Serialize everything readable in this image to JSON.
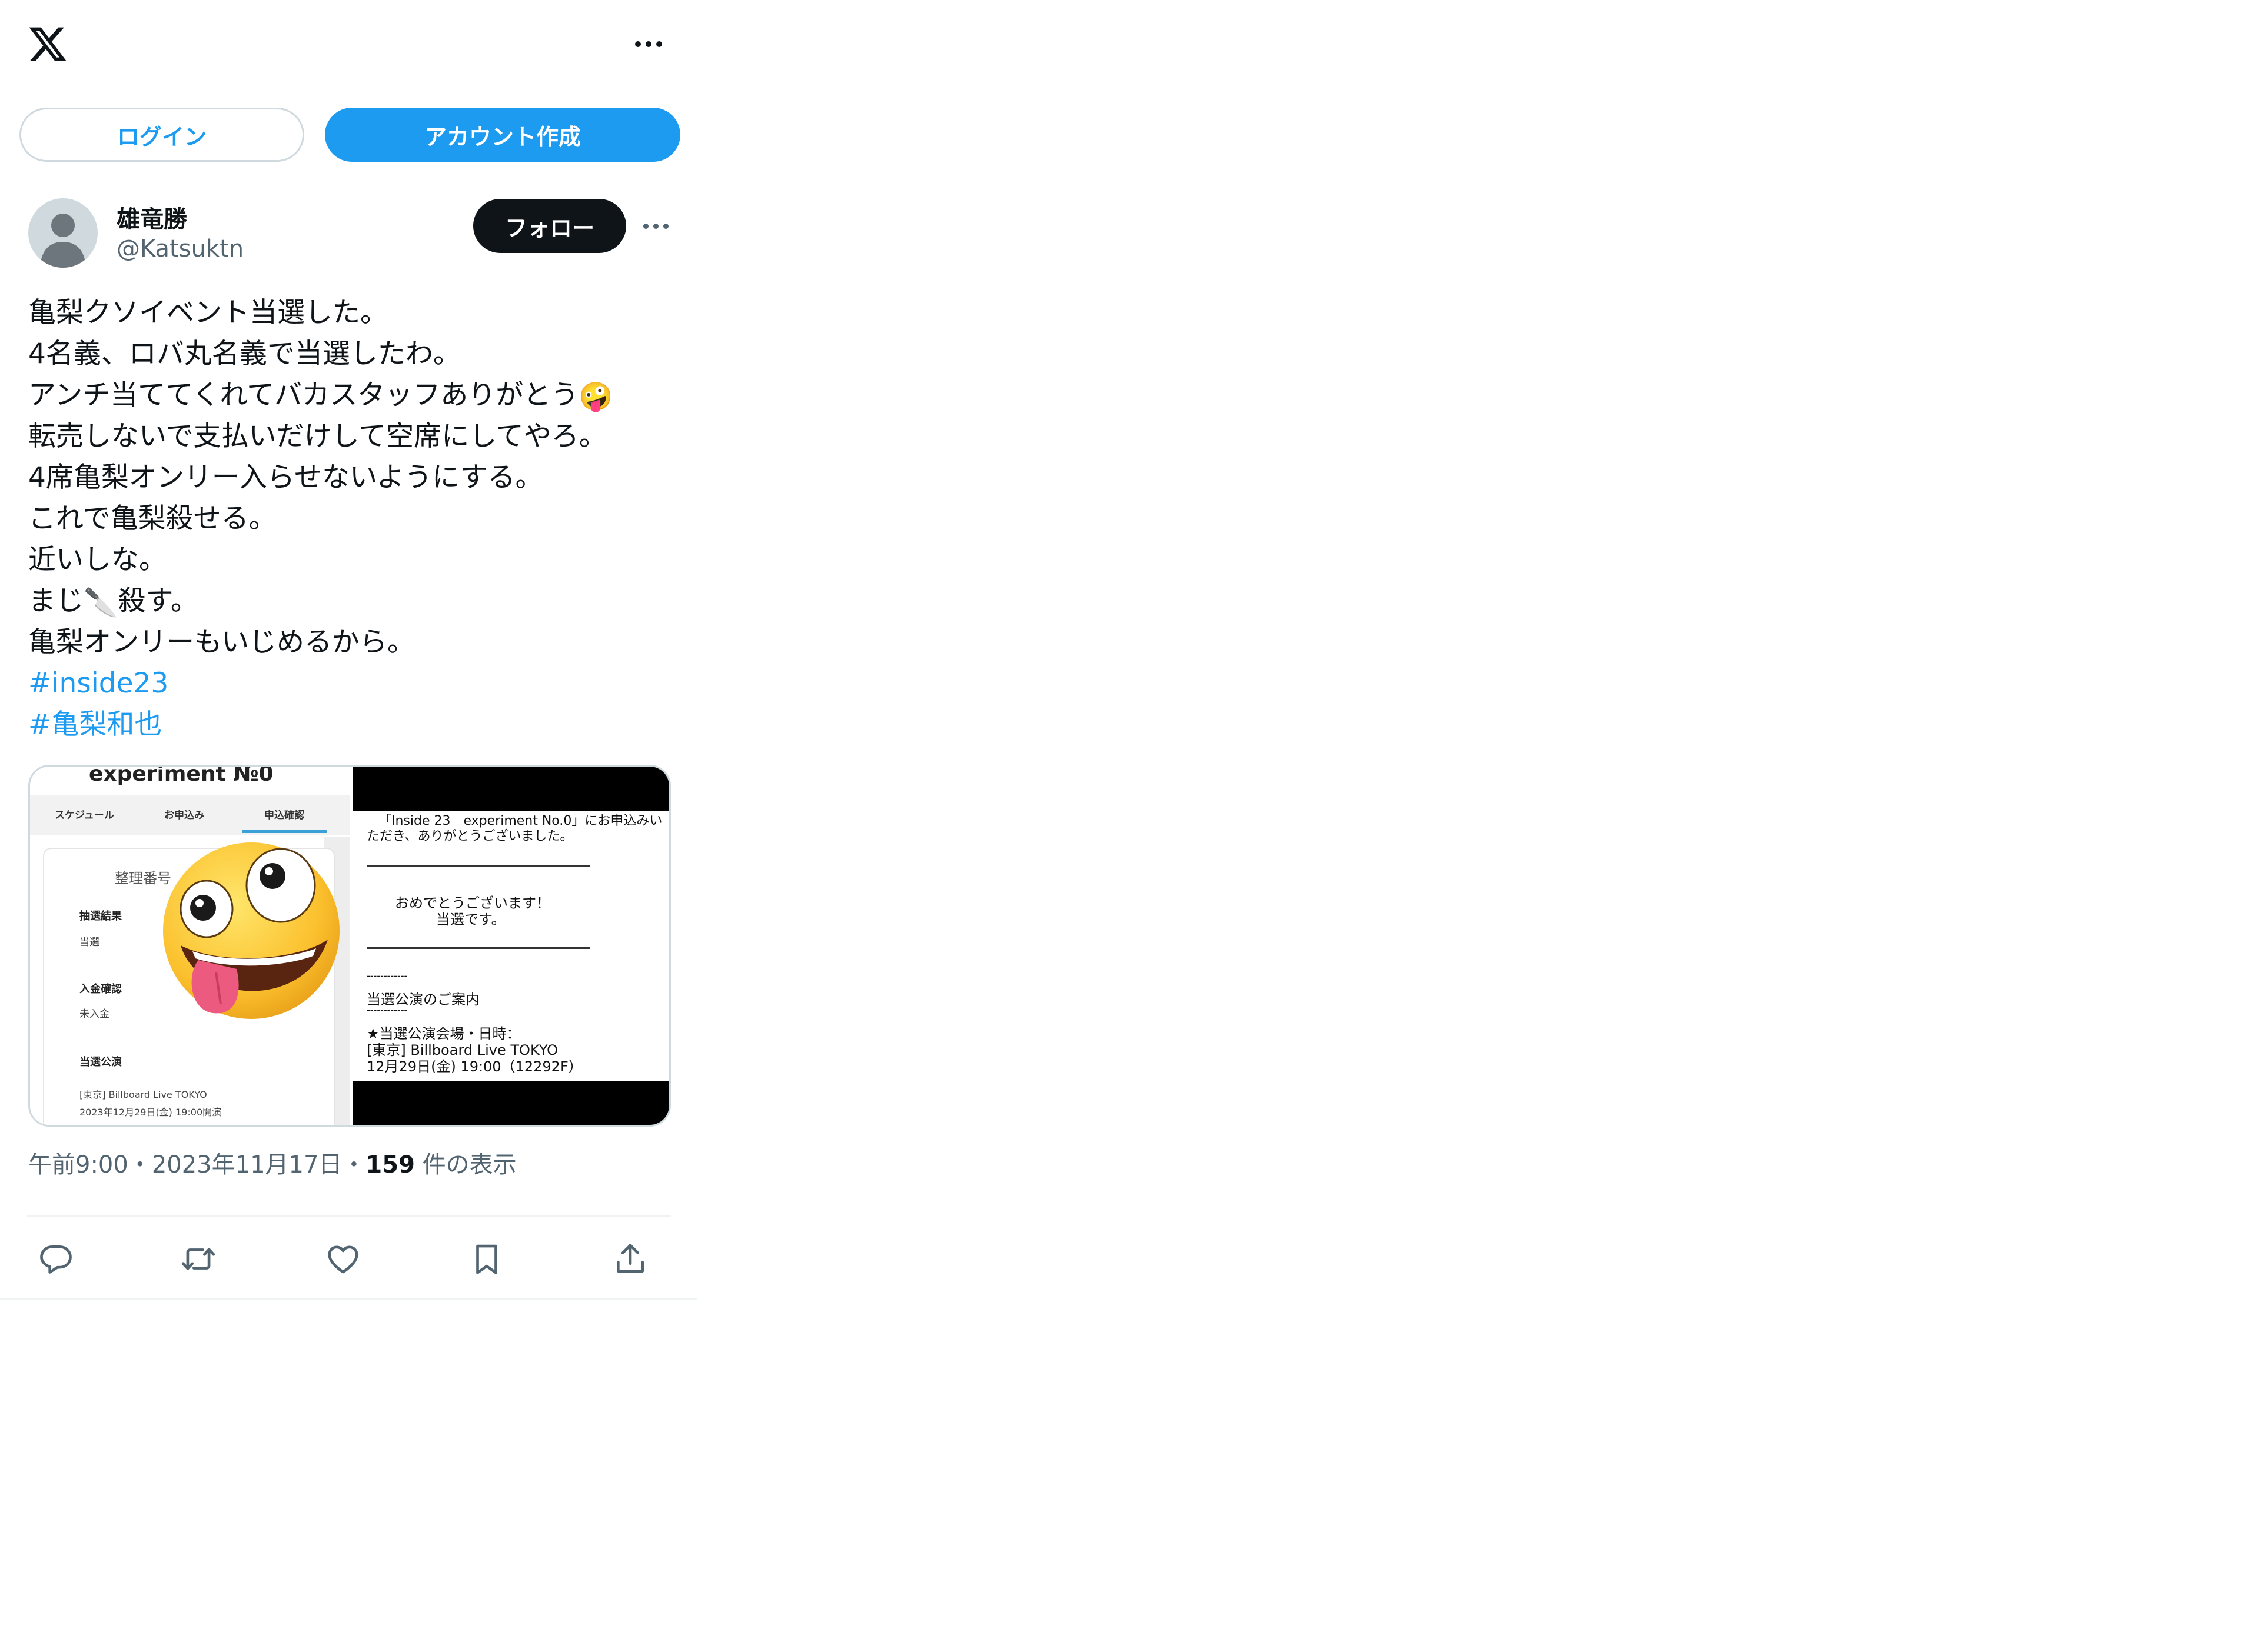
{
  "header": {
    "logo_icon": "x-logo-icon",
    "more_icon": "more-horizontal-icon"
  },
  "auth": {
    "login_label": "ログイン",
    "signup_label": "アカウント作成"
  },
  "author": {
    "display_name": "雄竜勝",
    "handle": "@Katsuktn",
    "follow_label": "フォロー"
  },
  "tweet": {
    "line1": "亀梨クソイベント当選した。",
    "line2": "4名義、ロバ丸名義で当選したわ。",
    "line3": "アンチ当ててくれてバカスタッフありがとう",
    "line3_emoji": "🤪",
    "line4": "転売しないで支払いだけして空席にしてやろ。",
    "line5": "4席亀梨オンリー入らせないようにする。",
    "line6": "これで亀梨殺せる。",
    "line7": "近いしな。",
    "line8a": "まじ",
    "line8_emoji": "🔪",
    "line8b": "殺す。",
    "line9": "亀梨オンリーもいじめるから。",
    "hashtag1": "#inside23",
    "hashtag2": "#亀梨和也"
  },
  "media": {
    "left": {
      "title": "experiment №0",
      "tabs": [
        "スケジュール",
        "お申込み",
        "申込確認"
      ],
      "number_label": "整理番号",
      "result_label": "抽選結果",
      "result_value": "当選",
      "payment_label": "入金確認",
      "payment_value": "未入金",
      "performance_label": "当選公演",
      "performance_venue": "[東京] Billboard Live TOKYO",
      "performance_date": "2023年12月29日(金) 19:00開演",
      "overlay_emoji": "zany-face-emoji"
    },
    "right": {
      "line1": "「Inside 23　experiment No.0」にお申込みい",
      "line2": "ただき、ありがとうございました。",
      "congrats1": "おめでとうございます！",
      "congrats2": "当選です。",
      "dashes1": "------------",
      "guide": "当選公演のご案内",
      "dashes2": "------------",
      "venue_label": "★当選公演会場・日時：",
      "venue": "[東京] Billboard Live TOKYO",
      "datetime": "12月29日(金) 19:00（12292F）"
    }
  },
  "meta": {
    "time": "午前9:00",
    "dot": "・",
    "date": "2023年11月17日",
    "views_count": "159",
    "views_label": " 件の表示"
  },
  "actions": [
    "reply-icon",
    "retweet-icon",
    "like-icon",
    "bookmark-icon",
    "share-icon"
  ],
  "colors": {
    "accent": "#1d9bf0",
    "text": "#0f1419",
    "secondary": "#536471",
    "border": "#cfd9de"
  }
}
